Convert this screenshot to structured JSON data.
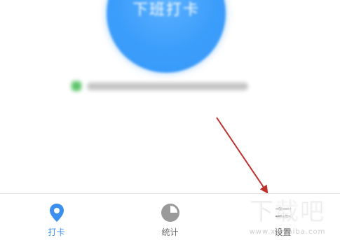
{
  "punch_card": {
    "label": "下班打卡",
    "time": ""
  },
  "location": {
    "text": ""
  },
  "tab_bar": {
    "items": [
      {
        "label": "打卡",
        "icon": "location-pin-icon",
        "active": true
      },
      {
        "label": "统计",
        "icon": "pie-chart-icon",
        "active": false
      },
      {
        "label": "设置",
        "icon": "settings-icon",
        "active": false
      }
    ]
  },
  "watermark": {
    "text": "下载吧",
    "url": "www.xiazaiba.com"
  },
  "colors": {
    "accent": "#3b9dfb",
    "tab_active": "#3b8ff0",
    "tab_inactive": "#6a6a6a",
    "annotation_arrow": "#c0312b"
  }
}
